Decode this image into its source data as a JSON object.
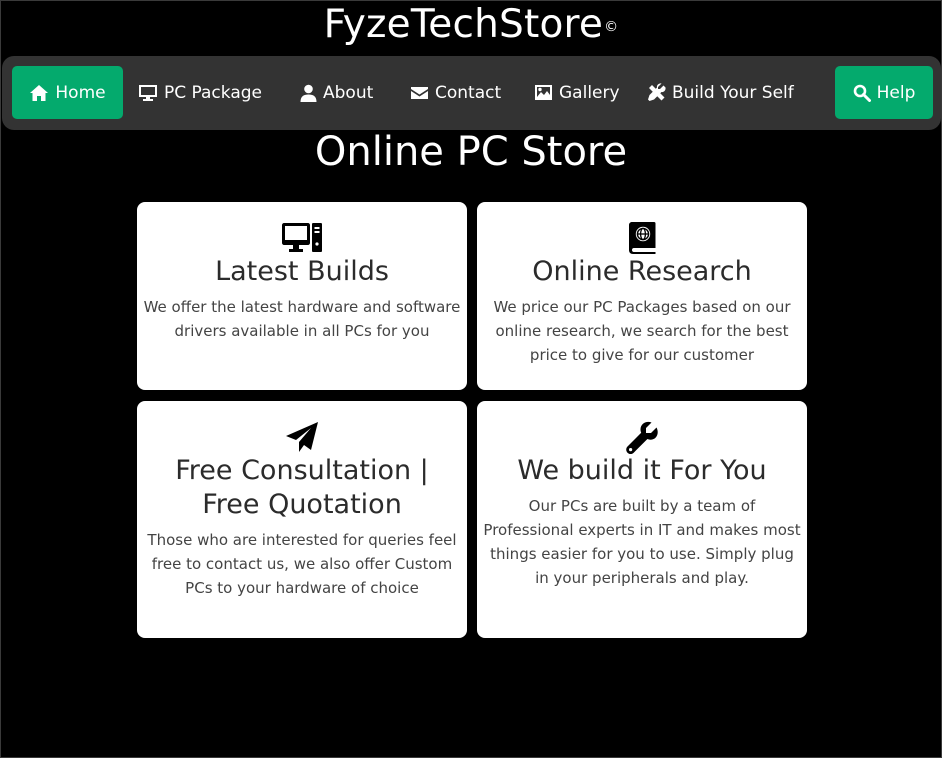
{
  "brand": {
    "name": "FyzeTechStore",
    "mark": "©"
  },
  "nav": {
    "home": "Home",
    "pc_package": "PC Package",
    "about": "About",
    "contact": "Contact",
    "gallery": "Gallery",
    "build": "Build Your Self",
    "help": "Help"
  },
  "colors": {
    "accent": "#04aa6d",
    "navbar": "#333333",
    "background": "#000000"
  },
  "main": {
    "title": "Online PC Store"
  },
  "cards": [
    {
      "icon": "computer-icon",
      "title": "Latest Builds",
      "text": "We offer the latest hardware and software drivers available in all PCs for you"
    },
    {
      "icon": "globe-book-icon",
      "title": "Online Research",
      "text": "We price our PC Packages based on our online research, we search for the best price to give for our customer"
    },
    {
      "icon": "paper-plane-icon",
      "title": "Free Consultation | Free Quotation",
      "text": "Those who are interested for queries feel free to contact us, we also offer Custom PCs to your hardware of choice"
    },
    {
      "icon": "wrench-icon",
      "title": "We build it For You",
      "text": "Our PCs are built by a team of Professional experts in IT and makes most things easier for you to use. Simply plug in your peripherals and play."
    }
  ]
}
